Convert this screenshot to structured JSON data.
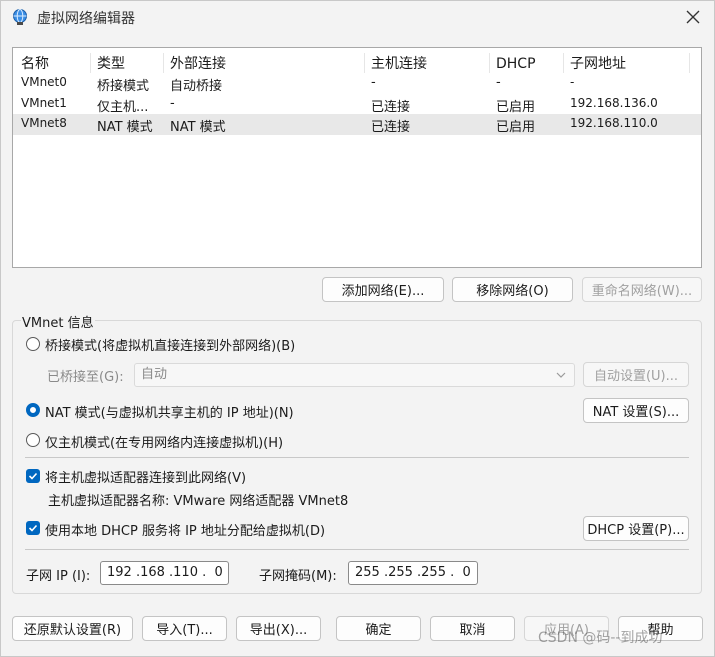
{
  "window": {
    "title": "虚拟网络编辑器"
  },
  "network_list": {
    "columns": [
      "名称",
      "类型",
      "外部连接",
      "主机连接",
      "DHCP",
      "子网地址"
    ],
    "rows": [
      {
        "name": "VMnet0",
        "type": "桥接模式",
        "external": "自动桥接",
        "host": "-",
        "dhcp": "-",
        "subnet": "-",
        "selected": false
      },
      {
        "name": "VMnet1",
        "type": "仅主机...",
        "external": "-",
        "host": "已连接",
        "dhcp": "已启用",
        "subnet": "192.168.136.0",
        "selected": false
      },
      {
        "name": "VMnet8",
        "type": "NAT 模式",
        "external": "NAT 模式",
        "host": "已连接",
        "dhcp": "已启用",
        "subnet": "192.168.110.0",
        "selected": true
      }
    ]
  },
  "list_buttons": {
    "add": "添加网络(E)...",
    "remove": "移除网络(O)",
    "rename": "重命名网络(W)..."
  },
  "vmnet_info": {
    "label": "VMnet 信息",
    "bridge_mode": "桥接模式(将虚拟机直接连接到外部网络)(B)",
    "bridged_to_label": "已桥接至(G):",
    "bridged_to_value": "自动",
    "auto_settings": "自动设置(U)...",
    "nat_mode": "NAT 模式(与虚拟机共享主机的 IP 地址)(N)",
    "nat_settings": "NAT 设置(S)...",
    "host_only": "仅主机模式(在专用网络内连接虚拟机)(H)",
    "connect_adapter": "将主机虚拟适配器连接到此网络(V)",
    "adapter_name": "主机虚拟适配器名称: VMware 网络适配器 VMnet8",
    "use_dhcp": "使用本地 DHCP 服务将 IP 地址分配给虚拟机(D)",
    "dhcp_settings": "DHCP 设置(P)...",
    "subnet_ip_label": "子网 IP (I):",
    "subnet_ip_value": "192 .168 .110 .  0",
    "subnet_mask_label": "子网掩码(M):",
    "subnet_mask_value": "255 .255 .255 .  0",
    "selected_mode": "nat",
    "connect_adapter_checked": true,
    "use_dhcp_checked": true
  },
  "footer_buttons": {
    "restore": "还原默认设置(R)",
    "import": "导入(T)...",
    "export": "导出(X)...",
    "ok": "确定",
    "cancel": "取消",
    "apply": "应用(A)",
    "help": "帮助"
  },
  "watermark": "CSDN @码--到成功",
  "colors": {
    "accent": "#0067c0",
    "selected_row": "#e8e8e8",
    "window_bg": "#f3f3f3"
  },
  "icons": {
    "title": "network-globe-icon",
    "close": "close-icon",
    "dropdown": "chevron-down-icon",
    "check": "checkmark-icon"
  }
}
